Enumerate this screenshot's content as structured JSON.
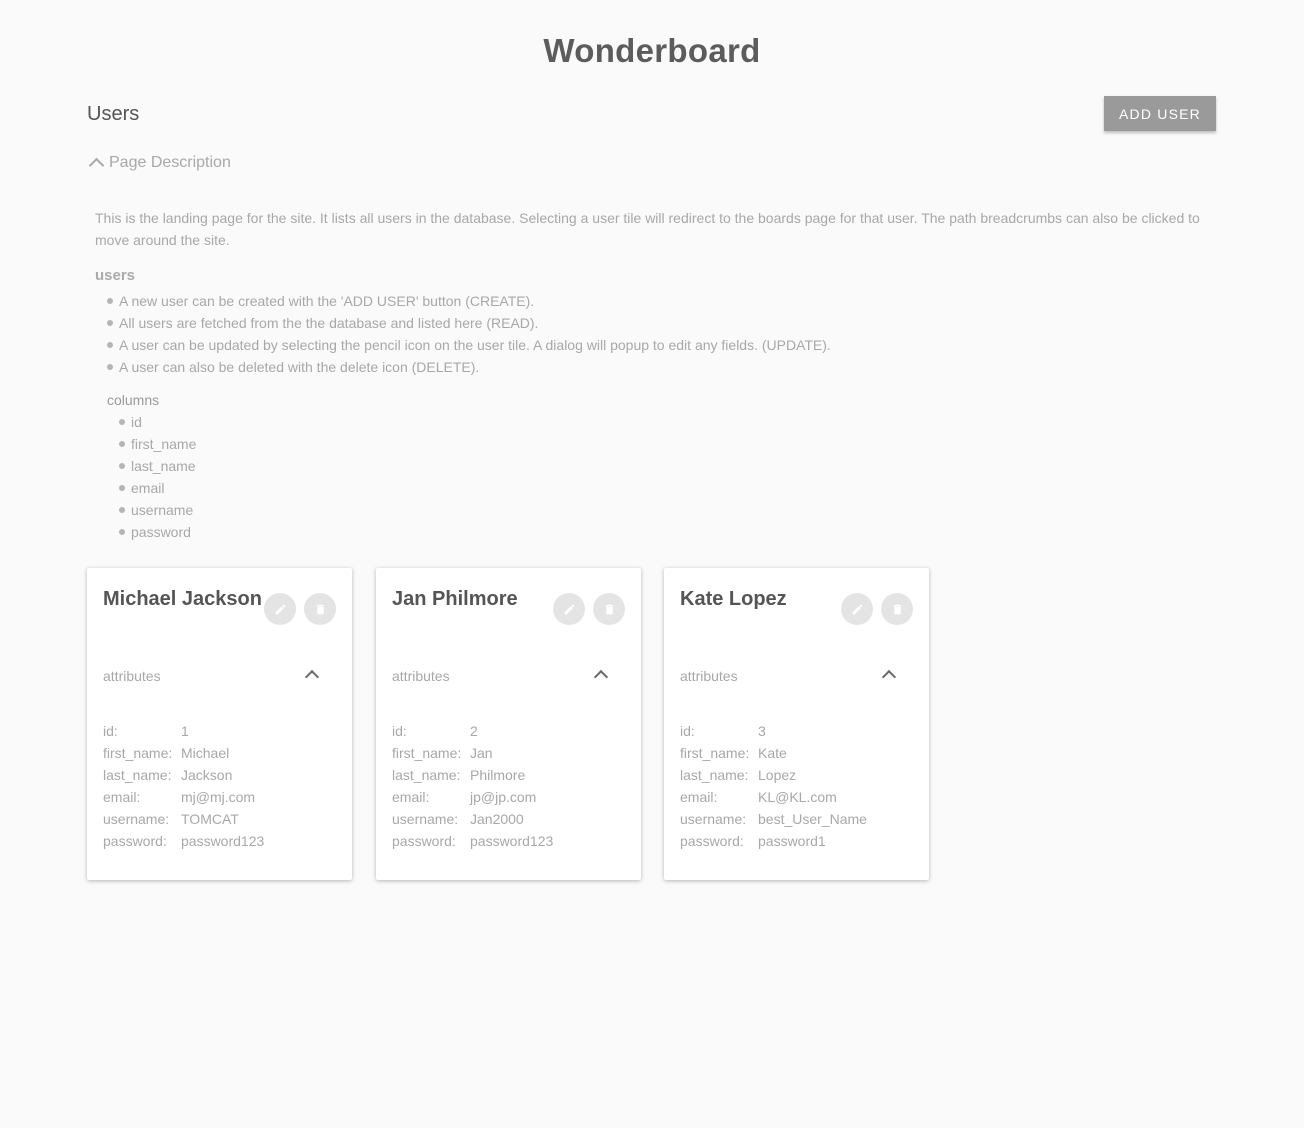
{
  "app": {
    "title": "Wonderboard"
  },
  "header": {
    "title": "Users",
    "add_user_label": "ADD USER"
  },
  "description": {
    "toggle_label": "Page Description",
    "intro": "This is the landing page for the site. It lists all users in the database. Selecting a user tile will redirect to the boards page for that user. The path breadcrumbs can also be clicked to move around the site.",
    "section_title": "users",
    "bullets": [
      "A new user can be created with the 'ADD USER' button (CREATE).",
      "All users are fetched from the the database and listed here (READ).",
      "A user can be updated by selecting the pencil icon on the user tile. A dialog will popup to edit any fields. (UPDATE).",
      "A user can also be deleted with the delete icon (DELETE)."
    ],
    "columns_label": "columns",
    "columns": [
      "id",
      "first_name",
      "last_name",
      "email",
      "username",
      "password"
    ]
  },
  "card_labels": {
    "attributes": "attributes",
    "keys": [
      "id:",
      "first_name:",
      "last_name:",
      "email:",
      "username:",
      "password:"
    ]
  },
  "icons": {
    "edit": "pencil-icon",
    "delete": "trash-icon",
    "toggle": "chevron-up-icon"
  },
  "users": [
    {
      "name": "Michael Jackson",
      "id": "1",
      "first_name": "Michael",
      "last_name": "Jackson",
      "email": "mj@mj.com",
      "username": "TOMCAT",
      "password": "password123"
    },
    {
      "name": "Jan Philmore",
      "id": "2",
      "first_name": "Jan",
      "last_name": "Philmore",
      "email": "jp@jp.com",
      "username": "Jan2000",
      "password": "password123"
    },
    {
      "name": "Kate Lopez",
      "id": "3",
      "first_name": "Kate",
      "last_name": "Lopez",
      "email": "KL@KL.com",
      "username": "best_User_Name",
      "password": "password1"
    }
  ]
}
